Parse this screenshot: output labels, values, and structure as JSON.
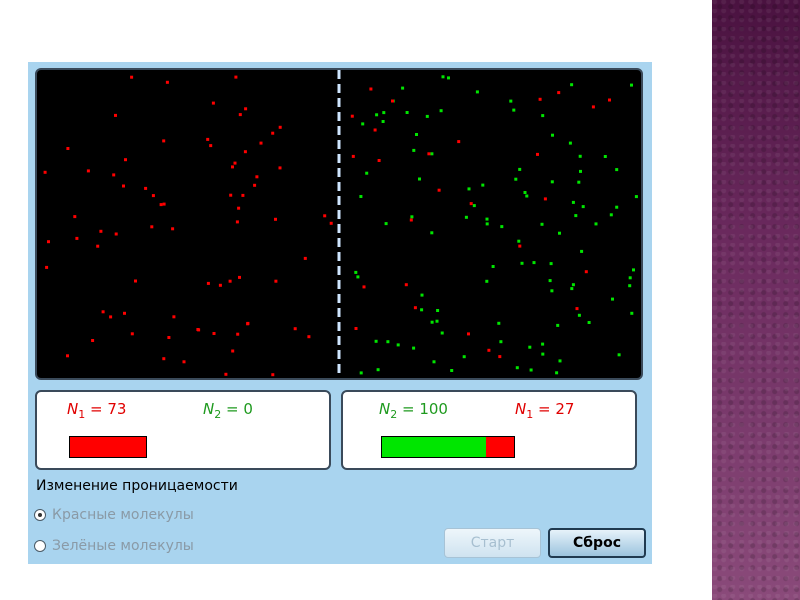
{
  "colors": {
    "red": "#ff0000",
    "green": "#00e600",
    "divider": "#cfe6ff"
  },
  "left_panel": {
    "n1": {
      "symbol": "N",
      "sub": "1",
      "eq": " = 73",
      "value": 73
    },
    "n2": {
      "symbol": "N",
      "sub": "2",
      "eq": " = 0",
      "value": 0
    }
  },
  "right_panel": {
    "n2": {
      "symbol": "N",
      "sub": "2",
      "eq": " = 100",
      "value": 100
    },
    "n1": {
      "symbol": "N",
      "sub": "1",
      "eq": " = 27",
      "value": 27
    }
  },
  "permeability": {
    "title": "Изменение проницаемости",
    "options": [
      {
        "label": "Красные молекулы",
        "selected": true
      },
      {
        "label": "Зелёные молекулы",
        "selected": false
      }
    ]
  },
  "buttons": {
    "start": "Старт",
    "reset": "Сброс"
  },
  "molecules": {
    "left_red": 73,
    "left_green": 0,
    "right_green": 100,
    "right_red": 27
  }
}
